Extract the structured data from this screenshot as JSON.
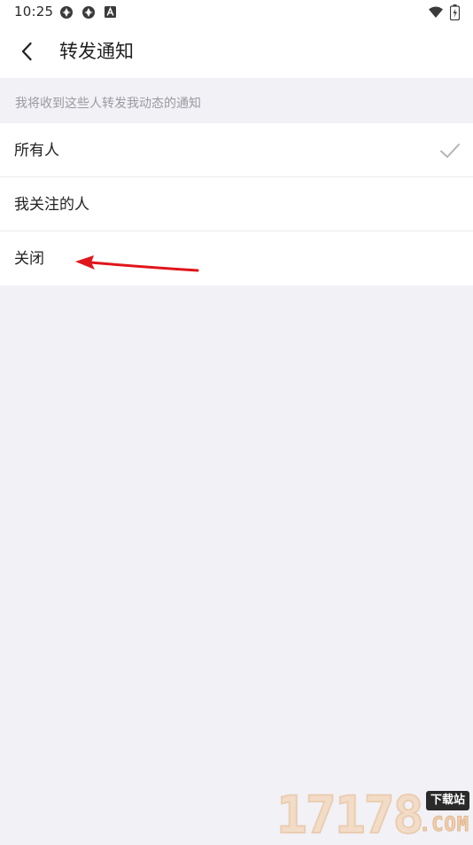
{
  "status_bar": {
    "time": "10:25",
    "left_icons": [
      "aperture-icon",
      "aperture-icon",
      "a-icon"
    ],
    "right_icons": [
      "wifi-icon",
      "battery-icon"
    ]
  },
  "app_bar": {
    "back_icon": "chevron-left-icon",
    "title": "转发通知"
  },
  "section": {
    "header": "我将收到这些人转发我动态的通知"
  },
  "options": [
    {
      "label": "所有人",
      "selected": true
    },
    {
      "label": "我关注的人",
      "selected": false
    },
    {
      "label": "关闭",
      "selected": false
    }
  ],
  "watermark": {
    "digits": "17178",
    "badge": "下载站",
    "domain": ".COM"
  },
  "colors": {
    "background": "#f2f1f6",
    "surface": "#ffffff",
    "header_text": "#9a9aa0",
    "check": "#b5b5ba",
    "arrow": "#e0161b"
  }
}
